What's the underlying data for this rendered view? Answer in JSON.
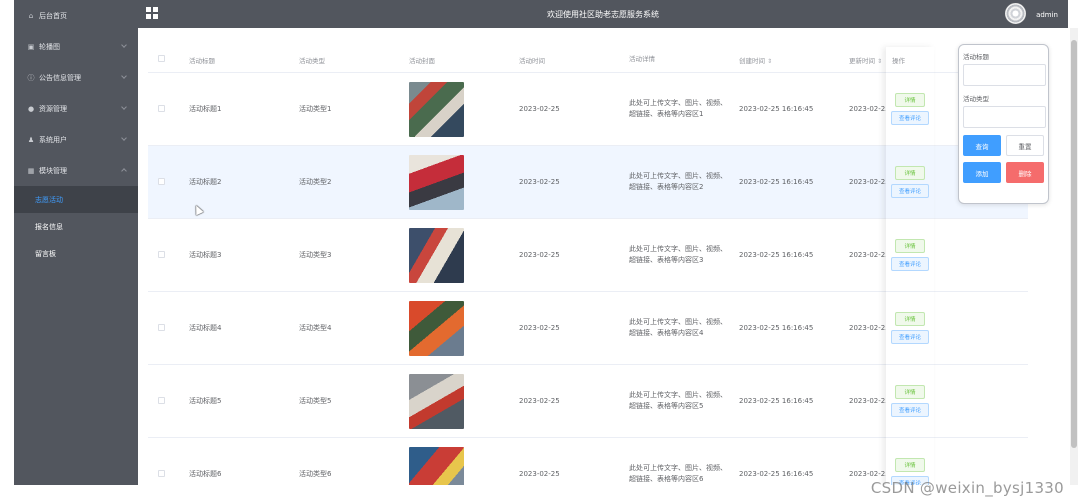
{
  "header": {
    "title": "欢迎使用社区助老志愿服务系统",
    "username": "admin",
    "menu_icon": "grid-icon",
    "avatar_icon": "avatar"
  },
  "sidebar": {
    "items": [
      {
        "label": "后台首页",
        "icon": "home-icon",
        "has_arrow": false
      },
      {
        "label": "轮播图",
        "icon": "image-icon",
        "has_arrow": true
      },
      {
        "label": "公告信息管理",
        "icon": "info-icon",
        "has_arrow": true
      },
      {
        "label": "资源管理",
        "icon": "location-icon",
        "has_arrow": true
      },
      {
        "label": "系统用户",
        "icon": "user-icon",
        "has_arrow": true
      },
      {
        "label": "模块管理",
        "icon": "module-icon",
        "has_arrow": true,
        "expanded": true
      }
    ],
    "sub_items": [
      {
        "label": "志愿活动",
        "active": true
      },
      {
        "label": "报名信息",
        "active": false
      },
      {
        "label": "留言板",
        "active": false
      }
    ]
  },
  "table": {
    "columns": {
      "title": "活动标题",
      "type": "活动类型",
      "cover": "活动封面",
      "time": "活动时间",
      "detail": "活动详情",
      "created": "创建时间",
      "updated": "更新时间",
      "ops": "操作"
    },
    "sort_glyph": "⇕",
    "rows": [
      {
        "title": "活动标题1",
        "type": "活动类型1",
        "time": "2023-02-25",
        "detail": "此处可上传文字、图片、视频、超链接、表格等内容区1",
        "created": "2023-02-25 16:16:45",
        "updated": "2023-02-25"
      },
      {
        "title": "活动标题2",
        "type": "活动类型2",
        "time": "2023-02-25",
        "detail": "此处可上传文字、图片、视频、超链接、表格等内容区2",
        "created": "2023-02-25 16:16:45",
        "updated": "2023-02-25"
      },
      {
        "title": "活动标题3",
        "type": "活动类型3",
        "time": "2023-02-25",
        "detail": "此处可上传文字、图片、视频、超链接、表格等内容区3",
        "created": "2023-02-25 16:16:45",
        "updated": "2023-02-25"
      },
      {
        "title": "活动标题4",
        "type": "活动类型4",
        "time": "2023-02-25",
        "detail": "此处可上传文字、图片、视频、超链接、表格等内容区4",
        "created": "2023-02-25 16:16:45",
        "updated": "2023-02-25"
      },
      {
        "title": "活动标题5",
        "type": "活动类型5",
        "time": "2023-02-25",
        "detail": "此处可上传文字、图片、视频、超链接、表格等内容区5",
        "created": "2023-02-25 16:16:45",
        "updated": "2023-02-25"
      },
      {
        "title": "活动标题6",
        "type": "活动类型6",
        "time": "2023-02-25",
        "detail": "此处可上传文字、图片、视频、超链接、表格等内容区6",
        "created": "2023-02-25 16:16:45",
        "updated": "2023-02-25"
      }
    ],
    "ops": {
      "detail_label": "详情",
      "comment_label": "查看评论"
    }
  },
  "search": {
    "title_label": "活动标题",
    "title_value": "",
    "type_label": "活动类型",
    "type_value": "",
    "query_label": "查询",
    "reset_label": "重置",
    "add_label": "添加",
    "delete_label": "删除"
  },
  "watermark": "CSDN @weixin_bysj1330",
  "colors": {
    "sidebar_bg": "#52565e",
    "header_bg": "#52565e",
    "active_link": "#409eff",
    "primary": "#409eff",
    "danger": "#f56c6c",
    "success": "#67c23a",
    "row_hover": "#f0f6ff"
  }
}
